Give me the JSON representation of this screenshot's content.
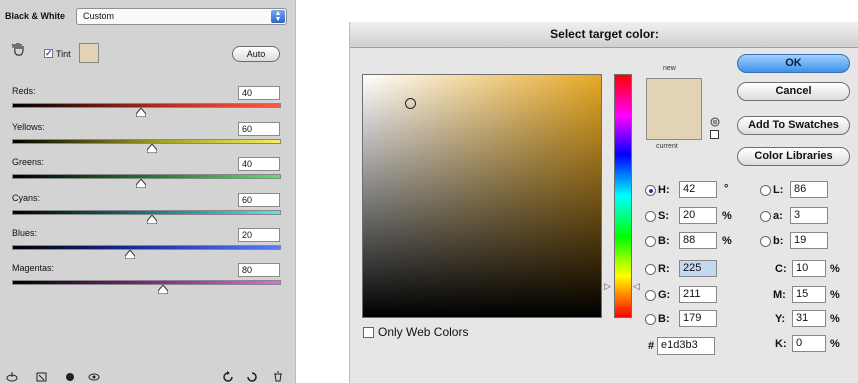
{
  "bw_panel": {
    "title": "Black & White",
    "preset": "Custom",
    "tint_label": "Tint",
    "tint_checked": true,
    "tint_color": "#e1d3b3",
    "auto_label": "Auto",
    "sliders": [
      {
        "label": "Reds:",
        "value": "40"
      },
      {
        "label": "Yellows:",
        "value": "60"
      },
      {
        "label": "Greens:",
        "value": "40"
      },
      {
        "label": "Cyans:",
        "value": "60"
      },
      {
        "label": "Blues:",
        "value": "20"
      },
      {
        "label": "Magentas:",
        "value": "80"
      }
    ],
    "footer_icons": [
      "clip-to-layer-icon",
      "view-previous-icon",
      "visibility-eye-icon",
      "eye-icon",
      "reset-icon",
      "refresh-icon",
      "trash-icon"
    ]
  },
  "picker": {
    "title": "Select target color:",
    "new_caption": "new",
    "current_caption": "current",
    "new_color": "#e1d3b3",
    "buttons": {
      "ok": "OK",
      "cancel": "Cancel",
      "add_swatches": "Add To Swatches",
      "color_libraries": "Color Libraries"
    },
    "hsb": [
      {
        "label": "H:",
        "value": "42",
        "unit": "°",
        "selected": true
      },
      {
        "label": "S:",
        "value": "20",
        "unit": "%",
        "selected": false
      },
      {
        "label": "B:",
        "value": "88",
        "unit": "%",
        "selected": false
      }
    ],
    "rgb": [
      {
        "label": "R:",
        "value": "225"
      },
      {
        "label": "G:",
        "value": "211"
      },
      {
        "label": "B:",
        "value": "179"
      }
    ],
    "lab": [
      {
        "label": "L:",
        "value": "86"
      },
      {
        "label": "a:",
        "value": "3"
      },
      {
        "label": "b:",
        "value": "19"
      }
    ],
    "cmyk": [
      {
        "label": "C:",
        "value": "10",
        "unit": "%"
      },
      {
        "label": "M:",
        "value": "15",
        "unit": "%"
      },
      {
        "label": "Y:",
        "value": "31",
        "unit": "%"
      },
      {
        "label": "K:",
        "value": "0",
        "unit": "%"
      }
    ],
    "hex_label": "#",
    "hex": "e1d3b3",
    "only_web_colors": "Only Web Colors"
  }
}
